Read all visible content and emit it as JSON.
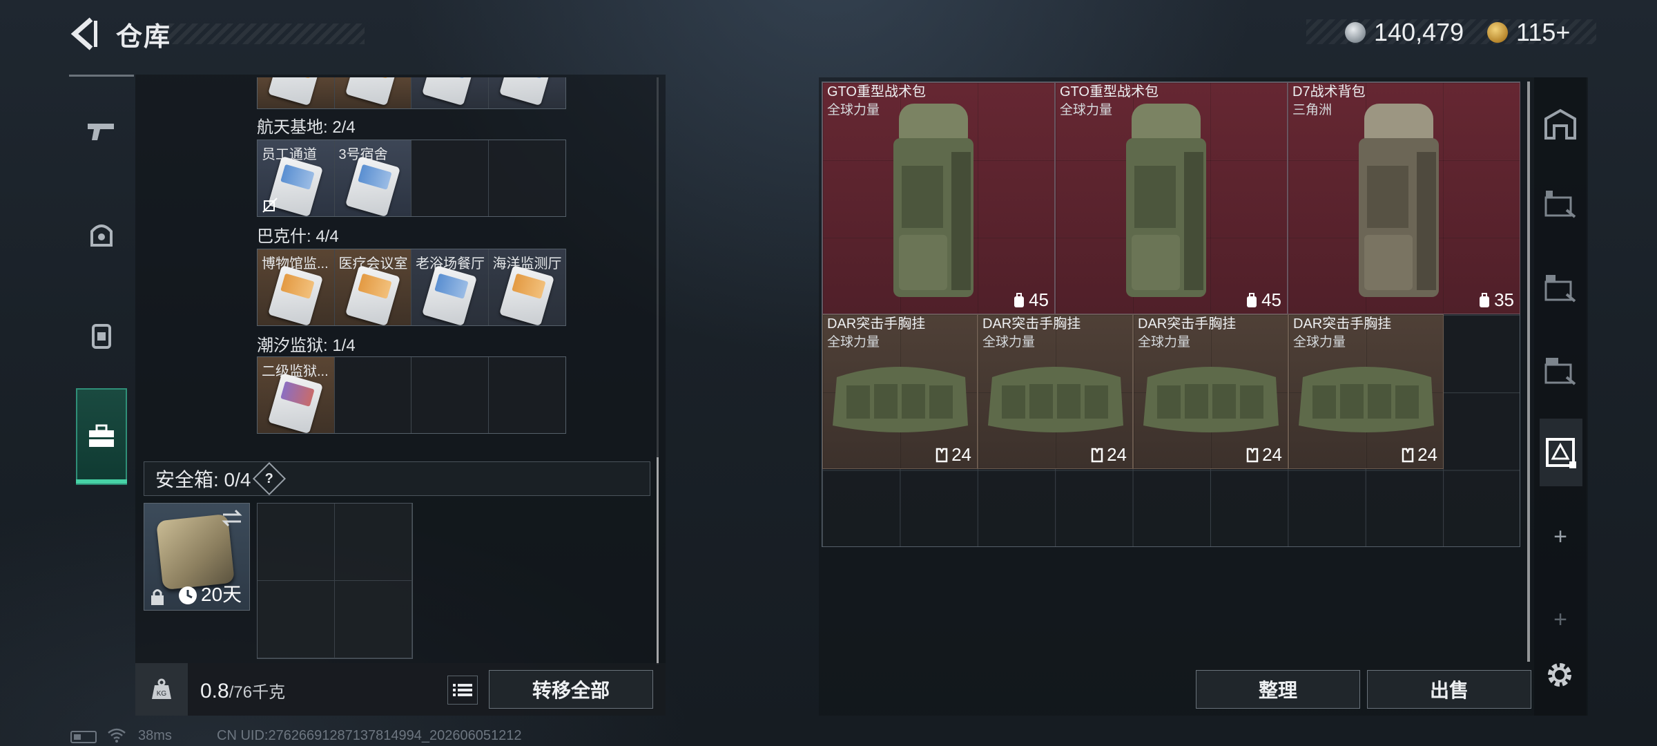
{
  "header": {
    "title": "仓库",
    "currency_silver": "140,479",
    "currency_gold": "115+"
  },
  "nav": {
    "items": [
      "weapon-icon",
      "armor-icon",
      "backpack-icon",
      "toolbox-icon"
    ],
    "active": "toolbox-icon"
  },
  "keycards": {
    "sections": [
      {
        "label": "航天基地: 2/4",
        "cells": [
          {
            "label": "员工通道",
            "color": "blue",
            "bg": "blue"
          },
          {
            "label": "3号宿舍",
            "color": "blue",
            "bg": "blue"
          },
          {
            "label": "",
            "color": "",
            "bg": "empty"
          },
          {
            "label": "",
            "color": "",
            "bg": "empty"
          }
        ]
      },
      {
        "label": "巴克什: 4/4",
        "cells": [
          {
            "label": "博物馆监...",
            "color": "orange",
            "bg": "brown"
          },
          {
            "label": "医疗会议室",
            "color": "orange",
            "bg": "brown"
          },
          {
            "label": "老浴场餐厅",
            "color": "blue",
            "bg": "dark"
          },
          {
            "label": "海洋监测厅",
            "color": "orange",
            "bg": "dark"
          }
        ]
      },
      {
        "label": "潮汐监狱: 1/4",
        "cells": [
          {
            "label": "二级监狱...",
            "color": "purple",
            "bg": "brown"
          },
          {
            "label": "",
            "color": "",
            "bg": "empty"
          },
          {
            "label": "",
            "color": "",
            "bg": "empty"
          },
          {
            "label": "",
            "color": "",
            "bg": "empty"
          }
        ]
      }
    ]
  },
  "safebox": {
    "title": "安全箱: 0/4",
    "help": "?",
    "days": "20天"
  },
  "bottom_left": {
    "weight_current": "0.8",
    "weight_max": "/76千克",
    "transfer_all": "转移全部"
  },
  "stash": {
    "items": [
      {
        "name": "GTO重型战术包",
        "sub": "全球力量",
        "cap": "45",
        "type": "backpack",
        "color": "#6e2834"
      },
      {
        "name": "GTO重型战术包",
        "sub": "全球力量",
        "cap": "45",
        "type": "backpack",
        "color": "#6e2834"
      },
      {
        "name": "D7战术背包",
        "sub": "三角洲",
        "cap": "35",
        "type": "backpack",
        "color": "#6e2834"
      },
      {
        "name": "DAR突击手胸挂",
        "sub": "全球力量",
        "cap": "24",
        "type": "rig",
        "color": "#524238"
      },
      {
        "name": "DAR突击手胸挂",
        "sub": "全球力量",
        "cap": "24",
        "type": "rig",
        "color": "#524238"
      },
      {
        "name": "DAR突击手胸挂",
        "sub": "全球力量",
        "cap": "24",
        "type": "rig",
        "color": "#524238"
      },
      {
        "name": "DAR突击手胸挂",
        "sub": "全球力量",
        "cap": "24",
        "type": "rig",
        "color": "#524238"
      }
    ]
  },
  "right_rail": {
    "items": [
      "stash-1-icon",
      "stash-2-icon",
      "stash-3-icon",
      "stash-4-icon",
      "stash-5-icon"
    ],
    "plus": "+"
  },
  "actions": {
    "sort": "整理",
    "sell": "出售"
  },
  "footer": {
    "ping": "38ms",
    "uid": "CN UID:27626691287137814994_202606051212"
  },
  "colors": {
    "accent_green": "#47d2a6",
    "stash_red": "#6e2834",
    "stash_brown": "#524238"
  }
}
